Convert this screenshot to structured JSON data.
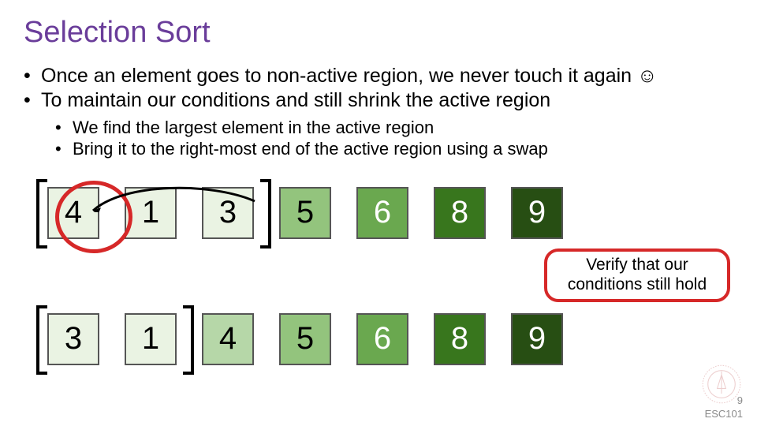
{
  "title": "Selection Sort",
  "bullets": [
    "Once an element goes to non-active region, we never touch it again ☺",
    "To maintain our conditions and still shrink the active region"
  ],
  "sub_bullets": [
    "We find the largest element in the active region",
    "Bring it to the right-most end of the active region using a swap"
  ],
  "row1": [
    "4",
    "1",
    "3",
    "5",
    "6",
    "8",
    "9"
  ],
  "row2": [
    "3",
    "1",
    "4",
    "5",
    "6",
    "8",
    "9"
  ],
  "callout": "Verify that our conditions still hold",
  "footer": {
    "course": "ESC101",
    "page": "9"
  }
}
